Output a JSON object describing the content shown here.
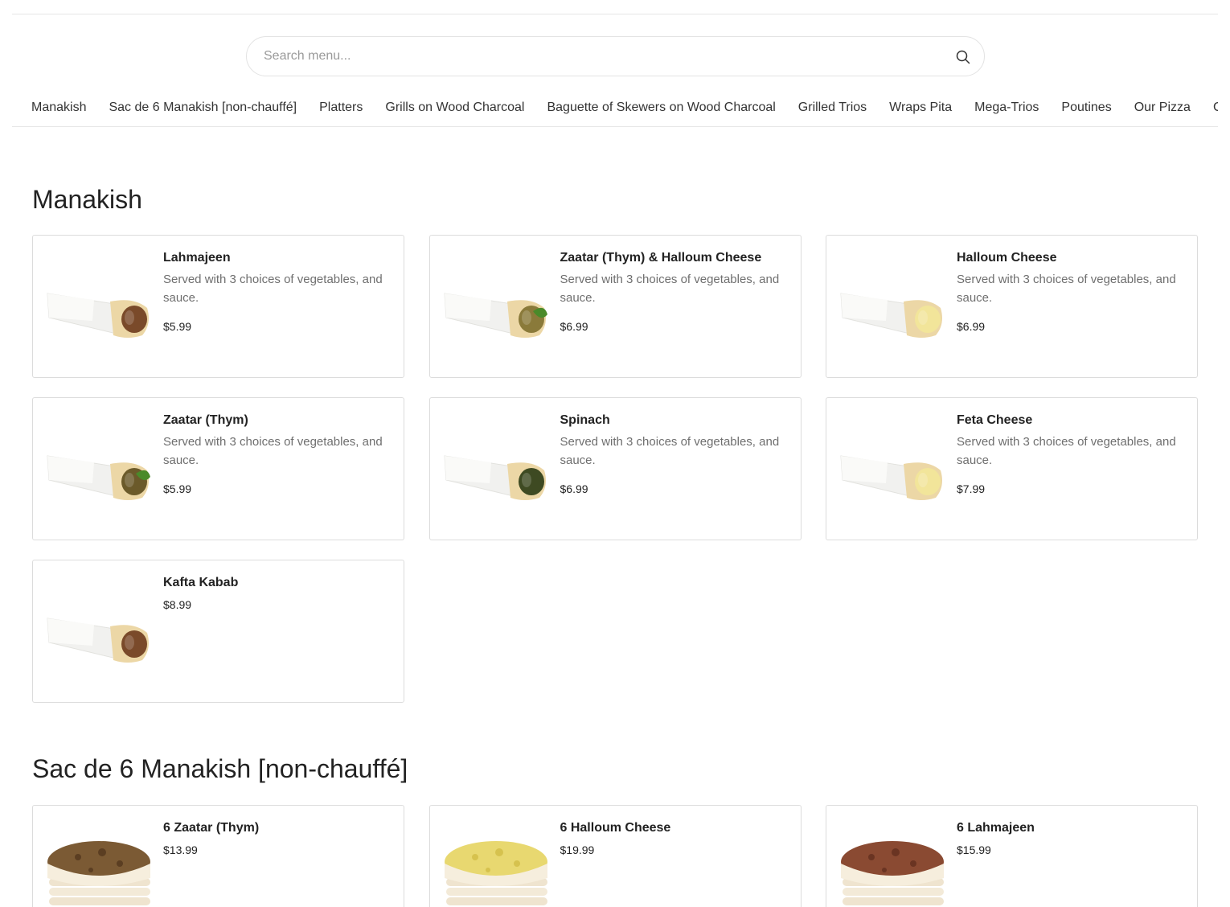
{
  "search": {
    "placeholder": "Search menu..."
  },
  "categories": [
    "Manakish",
    "Sac de 6 Manakish [non-chauffé]",
    "Platters",
    "Grills on Wood Charcoal",
    "Baguette of Skewers on Wood Charcoal",
    "Grilled Trios",
    "Wraps Pita",
    "Mega-Trios",
    "Poutines",
    "Our Pizza",
    "C"
  ],
  "sections": [
    {
      "title": "Manakish",
      "items": [
        {
          "name": "Lahmajeen",
          "description": "Served with 3 choices of vegetables, and sauce.",
          "price": "$5.99",
          "image": "wrap-meat"
        },
        {
          "name": "Zaatar (Thym) & Halloum Cheese",
          "description": "Served with 3 choices of vegetables, and sauce.",
          "price": "$6.99",
          "image": "wrap-zaatar-cheese"
        },
        {
          "name": "Halloum Cheese",
          "description": "Served with 3 choices of vegetables, and sauce.",
          "price": "$6.99",
          "image": "wrap-cheese"
        },
        {
          "name": "Zaatar (Thym)",
          "description": "Served with 3 choices of vegetables, and sauce.",
          "price": "$5.99",
          "image": "wrap-zaatar"
        },
        {
          "name": "Spinach",
          "description": "Served with 3 choices of vegetables, and sauce.",
          "price": "$6.99",
          "image": "wrap-spinach"
        },
        {
          "name": "Feta Cheese",
          "description": "Served with 3 choices of vegetables, and sauce.",
          "price": "$7.99",
          "image": "wrap-cheese"
        },
        {
          "name": "Kafta Kabab",
          "description": "",
          "price": "$8.99",
          "image": "wrap-meat"
        }
      ]
    },
    {
      "title": "Sac de 6 Manakish [non-chauffé]",
      "items": [
        {
          "name": "6 Zaatar (Thym)",
          "description": "",
          "price": "$13.99",
          "image": "stack-zaatar"
        },
        {
          "name": "6 Halloum Cheese",
          "description": "",
          "price": "$19.99",
          "image": "stack-cheese"
        },
        {
          "name": "6 Lahmajeen",
          "description": "",
          "price": "$15.99",
          "image": "stack-meat"
        }
      ]
    }
  ],
  "colors": {
    "border": "#dcdcdc",
    "text": "#222222",
    "muted": "#6f6f6f",
    "bread": "#ecd7a6",
    "meat": "#7a4a2a",
    "zaatar": "#6b5a2a",
    "cheese": "#f2e59a",
    "herb": "#4a8a2a",
    "tomato": "#d32f2f"
  }
}
